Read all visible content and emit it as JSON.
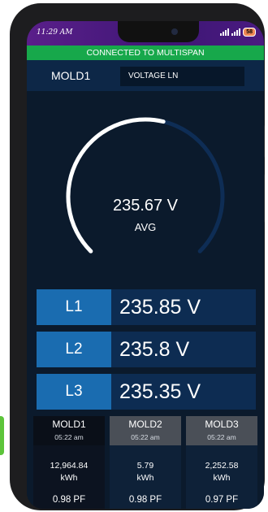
{
  "status": {
    "time": "11:29 AM",
    "battery": "58"
  },
  "banner": {
    "text": "CONNECTED TO MULTISPAN"
  },
  "header": {
    "mold": "MOLD1",
    "parameter": "VOLTAGE LN"
  },
  "gauge": {
    "value": "235.67 V",
    "label": "AVG",
    "level": 0.55
  },
  "phases": [
    {
      "label": "L1",
      "value": "235.85 V"
    },
    {
      "label": "L2",
      "value": "235.8 V"
    },
    {
      "label": "L3",
      "value": "235.35 V"
    }
  ],
  "molds": [
    {
      "name": "MOLD1",
      "time": "05:22 am",
      "energy": "12,964.84",
      "unit": "kWh",
      "pf": "0.98 PF"
    },
    {
      "name": "MOLD2",
      "time": "05:22 am",
      "energy": "5.79",
      "unit": "kWh",
      "pf": "0.98 PF"
    },
    {
      "name": "MOLD3",
      "time": "05:22 am",
      "energy": "2,252.58",
      "unit": "kWh",
      "pf": "0.97 PF"
    }
  ],
  "colors": {
    "connected": "#17a84b",
    "phase_label": "#1a6cb0",
    "gauge_track": "#0e2d55",
    "gauge_fill": "#ffffff"
  }
}
